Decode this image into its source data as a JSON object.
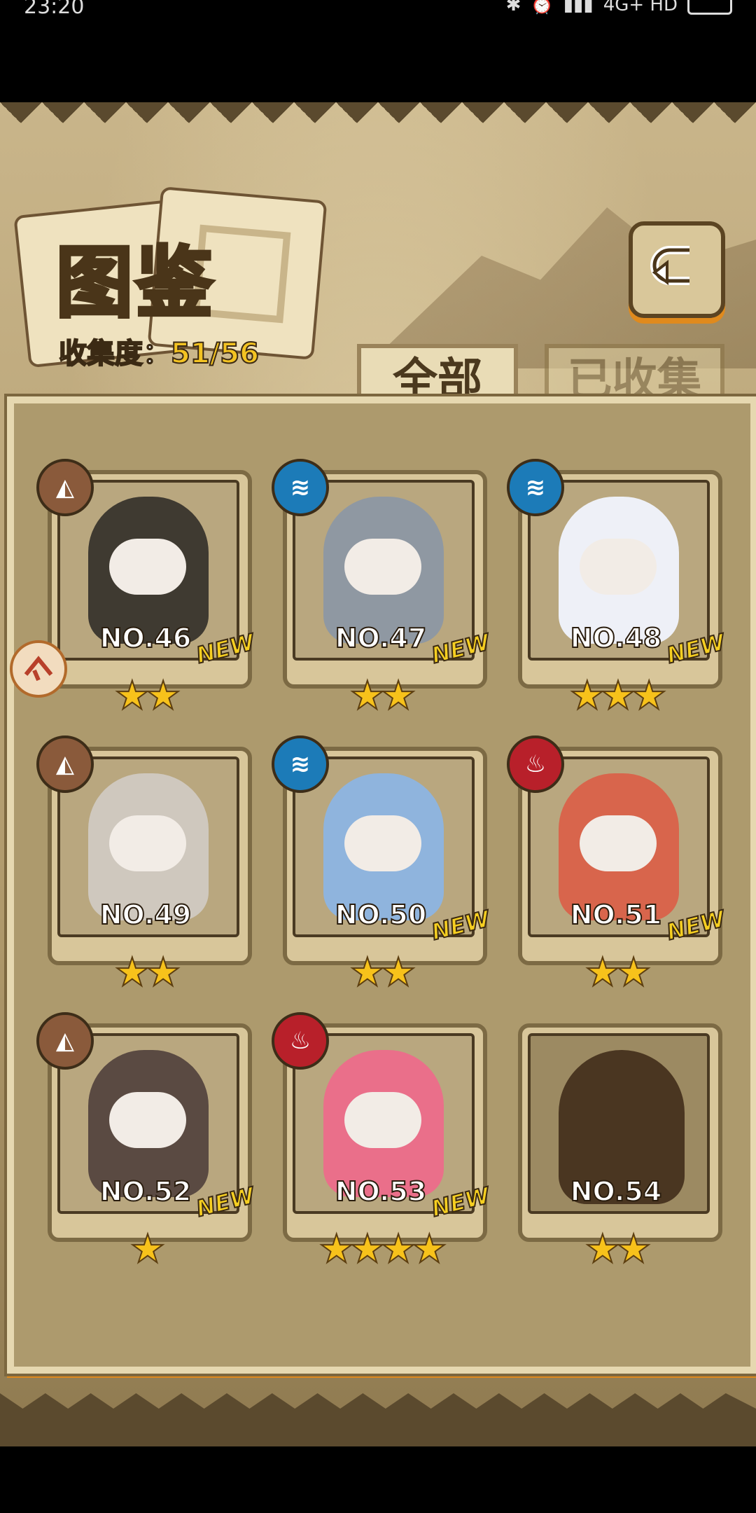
{
  "status": {
    "time": "23:20",
    "network": "4G+ HD"
  },
  "header": {
    "title": "图鉴",
    "progress_label": "收集度：",
    "progress_value": "51/56"
  },
  "tabs": [
    {
      "label": "全部",
      "active": true
    },
    {
      "label": "已收集",
      "active": false
    }
  ],
  "cards": [
    {
      "no": "NO.46",
      "element": "earth",
      "stars": "★★",
      "new": "NEW",
      "color": "#3f3a31"
    },
    {
      "no": "NO.47",
      "element": "water",
      "stars": "★★",
      "new": "NEW",
      "color": "#8f98a2"
    },
    {
      "no": "NO.48",
      "element": "water",
      "stars": "★★★",
      "new": "NEW",
      "color": "#eef0f7"
    },
    {
      "no": "NO.49",
      "element": "earth",
      "stars": "★★",
      "new": "",
      "color": "#cfc8be"
    },
    {
      "no": "NO.50",
      "element": "water",
      "stars": "★★",
      "new": "NEW",
      "color": "#8fb4dd"
    },
    {
      "no": "NO.51",
      "element": "fire",
      "stars": "★★",
      "new": "NEW",
      "color": "#d8654c"
    },
    {
      "no": "NO.52",
      "element": "earth",
      "stars": "★",
      "new": "NEW",
      "color": "#5a4a42"
    },
    {
      "no": "NO.53",
      "element": "fire",
      "stars": "★★★★",
      "new": "NEW",
      "color": "#ea6f8a"
    },
    {
      "no": "NO.54",
      "element": "",
      "stars": "★★",
      "new": "",
      "color": "#4a3621"
    }
  ]
}
